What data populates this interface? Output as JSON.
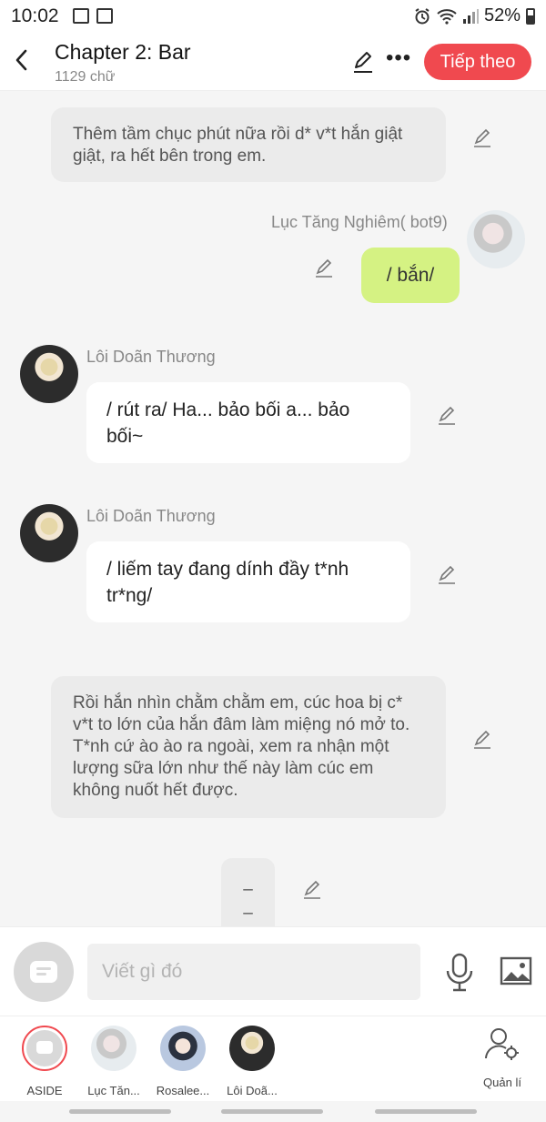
{
  "status_bar": {
    "time": "10:02",
    "battery": "52%"
  },
  "header": {
    "title": "Chapter 2: Bar",
    "word_count": "1129 chữ",
    "next_label": "Tiếp theo"
  },
  "chat": {
    "narration_1": "Thêm tầm chục phút nữa rồi d* v*t hắn giật giật, ra hết bên trong em.",
    "user_name": "Lục Tăng Nghiêm( bot9)",
    "user_message": "/ bắn/",
    "char_name_1": "Lôi Doãn Thương",
    "char_message_1": "/ rút ra/ Ha... bảo bối a... bảo bối~",
    "char_name_2": "Lôi Doãn Thương",
    "char_message_2": "/ liếm tay đang dính đầy t*nh tr*ng/",
    "narration_2": "Rồi hắn nhìn chằm chằm em, cúc hoa bị c* v*t to lớn của hắn đâm làm miệng nó mở to. T*nh cứ ào ào ra ngoài, xem ra nhận một lượng sữa lớn như thế này làm cúc em không nuốt hết được.",
    "dash_1": "–",
    "dash_2": "–"
  },
  "input": {
    "placeholder": "Viết gì đó"
  },
  "characters": [
    {
      "label": "ASIDE"
    },
    {
      "label": "Lục Tăn..."
    },
    {
      "label": "Rosalee..."
    },
    {
      "label": "Lôi Doã..."
    }
  ],
  "manage_label": "Quản lí",
  "colors": {
    "accent": "#f0494f",
    "user_bubble": "#d5f283",
    "narration_bg": "#ebebeb"
  }
}
